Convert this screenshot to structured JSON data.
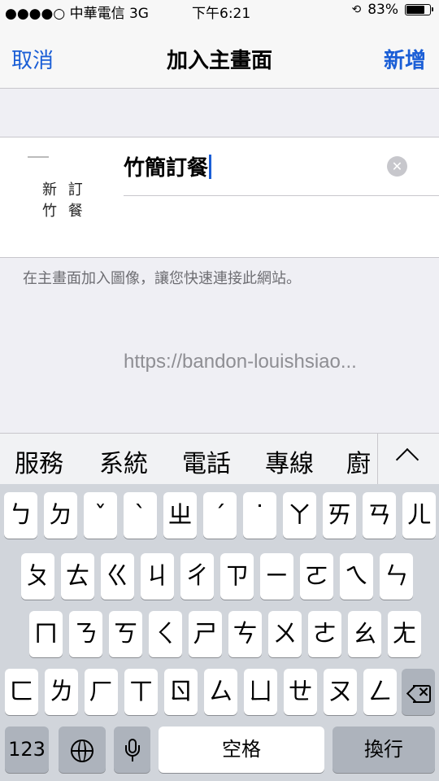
{
  "status_bar": {
    "carrier": "●●●●○ 中華電信  3G",
    "time": "下午6:21",
    "battery": "83%",
    "battery_level": 0.83,
    "lock_icon": "rotation-lock-icon"
  },
  "nav": {
    "cancel_label": "取消",
    "title": "加入主畫面",
    "add_label": "新增"
  },
  "bookmark": {
    "name_value": "竹簡訂餐",
    "url": "https://bandon-louishsiao...",
    "thumb_line1": "新 訂",
    "thumb_line2": "竹 餐",
    "hint": "在主畫面加入圖像，讓您快速連接此網站。"
  },
  "suggestions": [
    "服務",
    "系統",
    "電話",
    "專線",
    "廚"
  ],
  "keyboard": {
    "row1": [
      "ㄅ",
      "ㄉ",
      "ˇ",
      "ˋ",
      "ㄓ",
      "ˊ",
      "˙",
      "ㄚ",
      "ㄞ",
      "ㄢ",
      "ㄦ"
    ],
    "row2": [
      "ㄆ",
      "ㄊ",
      "ㄍ",
      "ㄐ",
      "ㄔ",
      "ㄗ",
      "ㄧ",
      "ㄛ",
      "ㄟ",
      "ㄣ"
    ],
    "row3": [
      "ㄇ",
      "ㄋ",
      "ㄎ",
      "ㄑ",
      "ㄕ",
      "ㄘ",
      "ㄨ",
      "ㄜ",
      "ㄠ",
      "ㄤ"
    ],
    "row4": [
      "ㄈ",
      "ㄌ",
      "ㄏ",
      "ㄒ",
      "ㄖ",
      "ㄙ",
      "ㄩ",
      "ㄝ",
      "ㄡ",
      "ㄥ"
    ],
    "numbers_label": "123",
    "space_label": "空格",
    "return_label": "換行"
  },
  "colors": {
    "accent": "#1a5ed6",
    "background": "#efeff4",
    "keyboard_bg": "#d1d5db"
  }
}
